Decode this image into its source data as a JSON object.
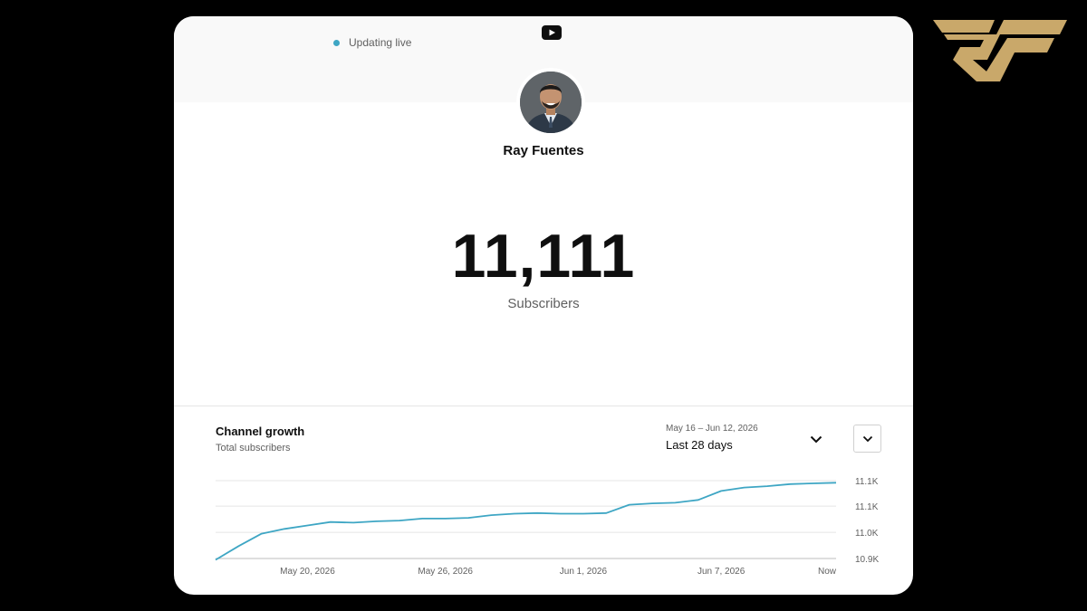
{
  "header": {
    "live_status": "Updating live"
  },
  "channel": {
    "name": "Ray Fuentes"
  },
  "subscribers": {
    "count": "11,111",
    "label": "Subscribers"
  },
  "growth": {
    "title": "Channel growth",
    "subtitle": "Total subscribers",
    "date_range": "May 16 – Jun 12, 2026",
    "period_label": "Last 28 days"
  },
  "colors": {
    "accent": "#3ea6c4",
    "logo_gold": "#c9a86a",
    "background": "#000000"
  },
  "icons": [
    "youtube-icon",
    "chevron-down-icon",
    "live-dot-icon"
  ],
  "chart_data": {
    "type": "line",
    "x": [
      "May 16",
      "May 17",
      "May 18",
      "May 19",
      "May 20",
      "May 21",
      "May 22",
      "May 23",
      "May 24",
      "May 25",
      "May 26",
      "May 27",
      "May 28",
      "May 29",
      "May 30",
      "May 31",
      "Jun 1",
      "Jun 2",
      "Jun 3",
      "Jun 4",
      "Jun 5",
      "Jun 6",
      "Jun 7",
      "Jun 8",
      "Jun 9",
      "Jun 10",
      "Jun 11",
      "Jun 12"
    ],
    "values": [
      10940,
      10960,
      10978,
      10985,
      10990,
      10995,
      10994,
      10996,
      10997,
      11000,
      11000,
      11001,
      11005,
      11007,
      11008,
      11007,
      11007,
      11008,
      11020,
      11022,
      11023,
      11027,
      11040,
      11045,
      11047,
      11050,
      11051,
      11052
    ],
    "x_tick_labels": [
      "May 20, 2026",
      "May 26, 2026",
      "Jun 1, 2026",
      "Jun 7, 2026",
      "Now"
    ],
    "x_tick_positions": [
      "May 20",
      "May 26",
      "Jun 1",
      "Jun 7",
      "Jun 12"
    ],
    "y_tick_labels": [
      "11.1K",
      "11.1K",
      "11.0K",
      "10.9K"
    ],
    "y_tick_values": [
      11055,
      11018,
      10980,
      10942
    ],
    "ylim": [
      10942,
      11055
    ],
    "grid": true,
    "line_color": "#3ea6c4"
  }
}
